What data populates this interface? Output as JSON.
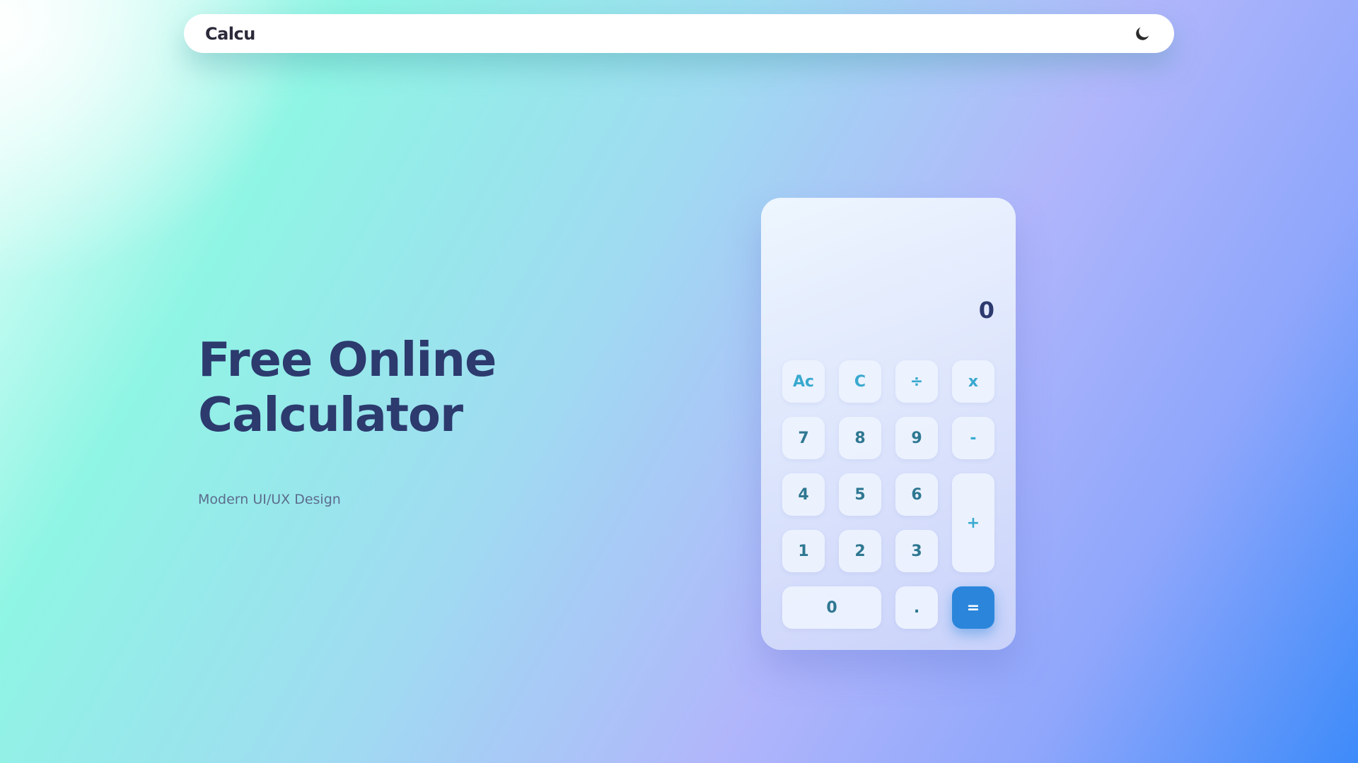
{
  "navbar": {
    "logo": "Calcu",
    "theme_toggle_icon": "moon-icon"
  },
  "hero": {
    "title_line1": "Free Online",
    "title_line2": "Calculator",
    "subtitle": "Modern UI/UX Design"
  },
  "calculator": {
    "display_value": "0",
    "keys": {
      "all_clear": "Ac",
      "clear": "C",
      "divide": "÷",
      "multiply": "x",
      "seven": "7",
      "eight": "8",
      "nine": "9",
      "minus": "-",
      "four": "4",
      "five": "5",
      "six": "6",
      "plus": "+",
      "one": "1",
      "two": "2",
      "three": "3",
      "zero": "0",
      "decimal": ".",
      "equals": "="
    }
  },
  "colors": {
    "heading": "#2c3a6e",
    "digit_key": "#2e7791",
    "operator_key": "#39a9cf",
    "equals_bg": "#2b86db"
  }
}
